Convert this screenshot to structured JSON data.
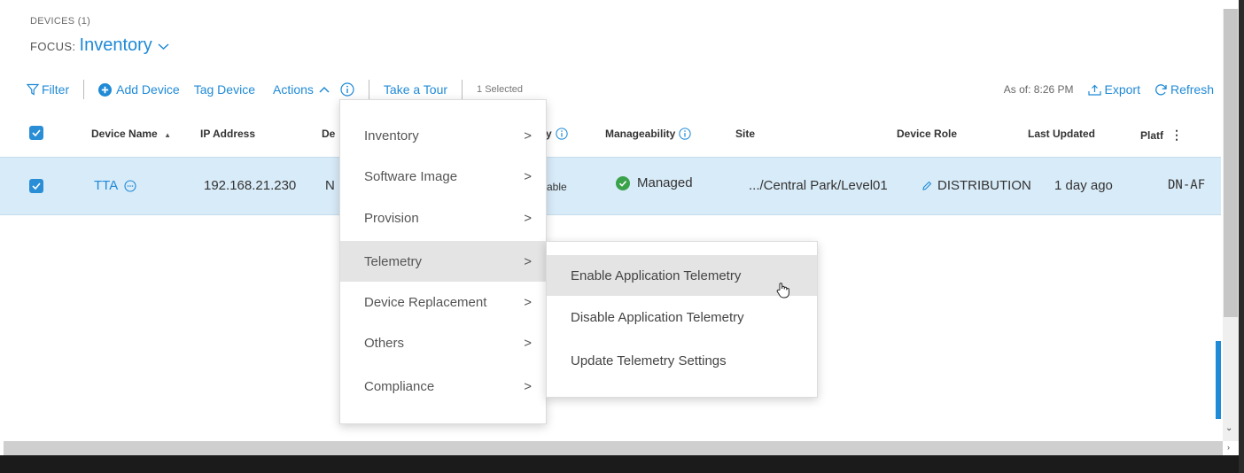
{
  "header": {
    "devices_count": "DEVICES (1)",
    "focus_label": "FOCUS:",
    "focus_value": "Inventory"
  },
  "toolbar": {
    "filter": "Filter",
    "add_device": "Add Device",
    "tag_device": "Tag Device",
    "actions": "Actions",
    "take_tour": "Take a Tour",
    "selected": "1 Selected",
    "as_of": "As of: 8:26 PM",
    "export": "Export",
    "refresh": "Refresh"
  },
  "table": {
    "headers": {
      "device_name": "Device Name",
      "ip_address": "IP Address",
      "device_type_partial": "De",
      "reachability_partial": "y",
      "manageability": "Manageability",
      "site": "Site",
      "device_role": "Device Role",
      "last_updated": "Last Updated",
      "platform": "Platf"
    },
    "rows": [
      {
        "device_name": "TTA",
        "ip_address": "192.168.21.230",
        "device_type_partial": "N",
        "reachability_partial": "able",
        "manageability": "Managed",
        "site": ".../Central Park/Level01",
        "device_role": "DISTRIBUTION",
        "last_updated": "1 day ago",
        "platform": "DN-AF"
      }
    ]
  },
  "actions_menu": {
    "items": [
      {
        "label": "Inventory"
      },
      {
        "label": "Software Image"
      },
      {
        "label": "Provision"
      },
      {
        "label": "Telemetry"
      },
      {
        "label": "Device Replacement"
      },
      {
        "label": "Others"
      },
      {
        "label": "Compliance"
      }
    ]
  },
  "telemetry_submenu": {
    "items": [
      {
        "label": "Enable Application Telemetry"
      },
      {
        "label": "Disable Application Telemetry"
      },
      {
        "label": "Update Telemetry Settings"
      }
    ]
  },
  "colors": {
    "accent": "#1f8ad6",
    "row_selected": "#d8ebf8",
    "managed_green": "#3aa24a",
    "menu_hover": "#e4e4e4"
  }
}
